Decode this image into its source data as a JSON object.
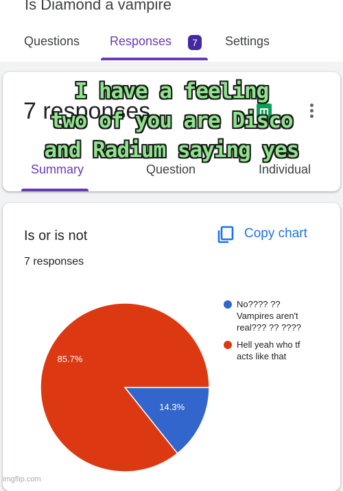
{
  "form": {
    "title": "Is Diamond a vampire"
  },
  "tabs": {
    "questions": "Questions",
    "responses": "Responses",
    "responses_badge": "7",
    "settings": "Settings"
  },
  "summary_card": {
    "count_text": "7 responses",
    "icons": {
      "sheets": "google-sheets-icon",
      "more": "more-vert-icon"
    },
    "subtabs": {
      "summary": "Summary",
      "question": "Question",
      "individual": "Individual"
    }
  },
  "question_card": {
    "title": "Is or is not",
    "count_text": "7 responses",
    "copy_chart": "Copy chart",
    "copy_icon": "copy-icon"
  },
  "overlay_caption": {
    "lines": [
      "I have a feeling",
      "two of you are Disco",
      "and Radium saying yes"
    ]
  },
  "watermark": "imgflip.com",
  "colors": {
    "accent": "#673ab7",
    "link": "#1a73e8",
    "slice_yes": "#dc3912",
    "slice_no": "#3366cc",
    "caption": "#8fe58d"
  },
  "chart_data": {
    "type": "pie",
    "labels": [
      "No???? ?? Vampires aren't real??? ?? ????",
      "Hell yeah who tf acts like that"
    ],
    "legend_lines": [
      [
        "No???? ??",
        "Vampires aren't",
        "real??? ?? ????"
      ],
      [
        "Hell yeah who tf",
        "acts like that"
      ]
    ],
    "values": [
      1,
      6
    ],
    "percent_labels": [
      "14.3%",
      "85.7%"
    ],
    "colors": [
      "#3366cc",
      "#dc3912"
    ],
    "legend_position": "right"
  }
}
